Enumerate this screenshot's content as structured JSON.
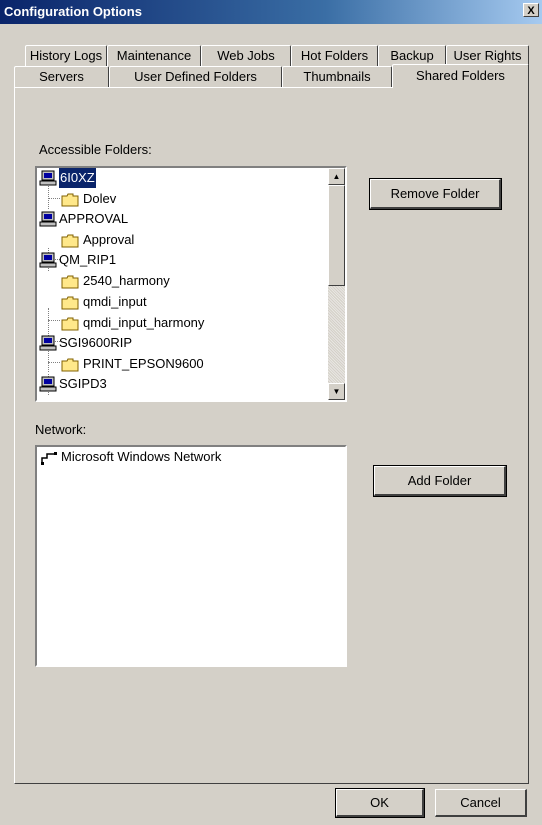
{
  "window": {
    "title": "Configuration Options",
    "close_label": "X"
  },
  "tabs": {
    "row1": [
      "History Logs",
      "Maintenance",
      "Web Jobs",
      "Hot Folders",
      "Backup",
      "User Rights"
    ],
    "row2": [
      "Servers",
      "User Defined Folders",
      "Thumbnails",
      "Shared Folders"
    ],
    "active": "Shared Folders"
  },
  "accessible": {
    "label": "Accessible Folders:",
    "tree": [
      {
        "type": "computer",
        "label": "6I0XZ",
        "selected": true
      },
      {
        "type": "folder",
        "label": "Dolev"
      },
      {
        "type": "computer",
        "label": "APPROVAL"
      },
      {
        "type": "folder",
        "label": "Approval"
      },
      {
        "type": "computer",
        "label": "QM_RIP1"
      },
      {
        "type": "folder",
        "label": "2540_harmony"
      },
      {
        "type": "folder",
        "label": "qmdi_input"
      },
      {
        "type": "folder",
        "label": "qmdi_input_harmony"
      },
      {
        "type": "computer",
        "label": "SGI9600RIP"
      },
      {
        "type": "folder",
        "label": "PRINT_EPSON9600"
      },
      {
        "type": "computer",
        "label": "SGIPD3"
      }
    ],
    "remove_button": "Remove Folder"
  },
  "network": {
    "label": "Network:",
    "items": [
      {
        "label": "Microsoft Windows Network"
      }
    ],
    "add_button": "Add Folder"
  },
  "footer": {
    "ok": "OK",
    "cancel": "Cancel"
  }
}
